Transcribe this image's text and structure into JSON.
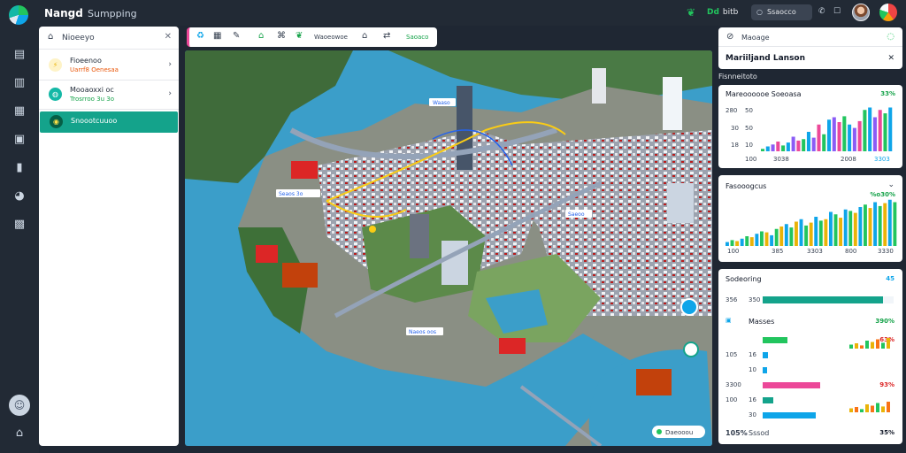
{
  "app": {
    "title": "Nangd",
    "subtitle": "Sumpping"
  },
  "topbar": {
    "status_green": "Dd",
    "status_text": "bitb",
    "search_label": "Ssaocco",
    "icons": [
      "leaf-icon",
      "search-icon",
      "notification-icon",
      "settings-icon"
    ]
  },
  "rail": {
    "icons": [
      "layers-icon",
      "document-icon",
      "chart-icon",
      "image-icon",
      "file-icon",
      "pin-icon",
      "group-icon"
    ]
  },
  "left_panel": {
    "title": "Nioeeyo",
    "items": [
      {
        "title": "Fioeenoo",
        "subtitle": "Uarrf8 Oenesaa",
        "color": "#eab308",
        "subtitle_color": "#ea580c"
      },
      {
        "title": "Mooaoxxi oc",
        "subtitle": "Trosrroo 3u 3o",
        "color": "#14b8a6",
        "subtitle_color": "#16a34a"
      },
      {
        "title": "Snoootcuuoo",
        "color": "#ffffff"
      }
    ]
  },
  "map_toolbar": {
    "label1": "Waoeowoe",
    "label2": "Saoaco"
  },
  "map": {
    "callouts": [
      "Waaso",
      "Seaos 3o",
      "Naeos oos",
      "Saeoo"
    ],
    "badge": "Daeooou"
  },
  "panel_nav": {
    "title": "Maoage",
    "header": "Mariiljand Lanson",
    "section": "Fisnneitoto"
  },
  "panel_metrics": {
    "title": "Mareoooooe Soeoasa",
    "pct": "33%",
    "ylabels": [
      "280",
      "30",
      "18"
    ],
    "ylabels2": [
      "50",
      "50",
      "10"
    ],
    "xlabels": [
      "100",
      "3038",
      "2008",
      "3303"
    ],
    "bars": [
      0.05,
      0.1,
      0.14,
      0.2,
      0.12,
      0.18,
      0.3,
      0.22,
      0.25,
      0.4,
      0.28,
      0.55,
      0.35,
      0.65,
      0.7,
      0.6,
      0.72,
      0.55,
      0.48,
      0.62,
      0.85,
      0.9,
      0.7,
      0.85,
      0.78,
      0.9
    ],
    "colors": [
      "#22c55e",
      "#0ea5e9",
      "#8b5cf6",
      "#ec4899"
    ]
  },
  "panel_overview": {
    "title": "Fasooogcus",
    "pct": "%o30%",
    "xlabels": [
      "100",
      "385",
      "3303",
      "800",
      "3330"
    ],
    "bars": [
      0.08,
      0.12,
      0.1,
      0.15,
      0.2,
      0.18,
      0.25,
      0.3,
      0.28,
      0.22,
      0.35,
      0.4,
      0.45,
      0.38,
      0.5,
      0.55,
      0.42,
      0.48,
      0.6,
      0.52,
      0.55,
      0.7,
      0.65,
      0.58,
      0.75,
      0.72,
      0.68,
      0.8,
      0.85,
      0.78,
      0.9,
      0.82,
      0.88,
      0.95,
      0.9
    ],
    "colors": [
      "#0ea5e9",
      "#22c55e",
      "#eab308"
    ]
  },
  "panel_usage": {
    "title": "Sodeoring",
    "pct": "45",
    "row1": {
      "v1": "356",
      "v2": "350",
      "fill": 0.92,
      "color": "#14a38b"
    },
    "sub": {
      "title": "Masses",
      "pct": "390%"
    },
    "rows": [
      {
        "label": "",
        "value": "",
        "fill": 0.28,
        "color": "#22c55e",
        "pct": "63%"
      },
      {
        "label": "105",
        "value": "16",
        "fill": 0.06,
        "color": "#0ea5e9",
        "pct": ""
      },
      {
        "label": "",
        "value": "10",
        "fill": 0.05,
        "color": "#0ea5e9",
        "pct": ""
      },
      {
        "label": "3300",
        "value": "",
        "fill": 0.65,
        "color": "#ec4899",
        "pct": "93%"
      },
      {
        "label": "100",
        "value": "16",
        "fill": 0.12,
        "color": "#14a38b",
        "pct": ""
      },
      {
        "label": "",
        "value": "30",
        "fill": 0.6,
        "color": "#0ea5e9",
        "pct": ""
      }
    ],
    "footer_left": "105%",
    "footer_mid": "Sssod",
    "footer_pct": "35%"
  }
}
